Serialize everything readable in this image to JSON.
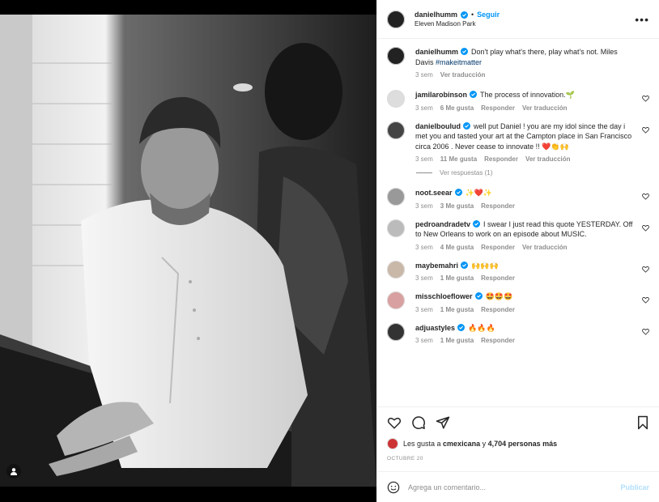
{
  "header": {
    "username": "danielhumm",
    "follow_label": "Seguir",
    "location": "Eleven Madison Park",
    "more_label": "•••"
  },
  "caption": {
    "username": "danielhumm",
    "text": "Don't play what's there, play what's not. Miles Davis ",
    "hashtag": "#makeitmatter",
    "time": "3 sem",
    "translate": "Ver traducción"
  },
  "comments": [
    {
      "username": "jamilarobinson",
      "text": "The process of innovation.🌱",
      "time": "3 sem",
      "likes": "6 Me gusta",
      "reply": "Responder",
      "translate": "Ver traducción"
    },
    {
      "username": "danielboulud",
      "text": "well put Daniel ! you are my idol since the day i met you and tasted your art at the Campton place in San Francisco circa 2006 . Never cease to innovate !! ❤️👏🙌",
      "time": "3 sem",
      "likes": "11 Me gusta",
      "reply": "Responder",
      "translate": "Ver traducción"
    },
    {
      "username": "noot.seear",
      "text": "✨❤️✨",
      "time": "3 sem",
      "likes": "3 Me gusta",
      "reply": "Responder",
      "translate": ""
    },
    {
      "username": "pedroandradetv",
      "text": "I swear I just read this quote YESTERDAY. Off to New Orleans to work on an episode about MUSIC.",
      "time": "3 sem",
      "likes": "4 Me gusta",
      "reply": "Responder",
      "translate": "Ver traducción"
    },
    {
      "username": "maybemahri",
      "text": "🙌🙌🙌",
      "time": "3 sem",
      "likes": "1 Me gusta",
      "reply": "Responder",
      "translate": ""
    },
    {
      "username": "misschloeflower",
      "text": "🤩🤩🤩",
      "time": "3 sem",
      "likes": "1 Me gusta",
      "reply": "Responder",
      "translate": ""
    },
    {
      "username": "adjuastyles",
      "text": "🔥🔥🔥",
      "time": "3 sem",
      "likes": "1 Me gusta",
      "reply": "Responder",
      "translate": ""
    }
  ],
  "view_replies": "Ver respuestas (1)",
  "likes_line": {
    "prefix": "Les gusta a ",
    "user": "cmexicana",
    "middle": " y ",
    "count": "4,704 personas más"
  },
  "date": "OCTUBRE 20",
  "compose": {
    "placeholder": "Agrega un comentario...",
    "post_label": "Publicar"
  },
  "colors": {
    "accent": "#0095f6",
    "muted": "#8e8e8e",
    "link": "#00376b"
  }
}
